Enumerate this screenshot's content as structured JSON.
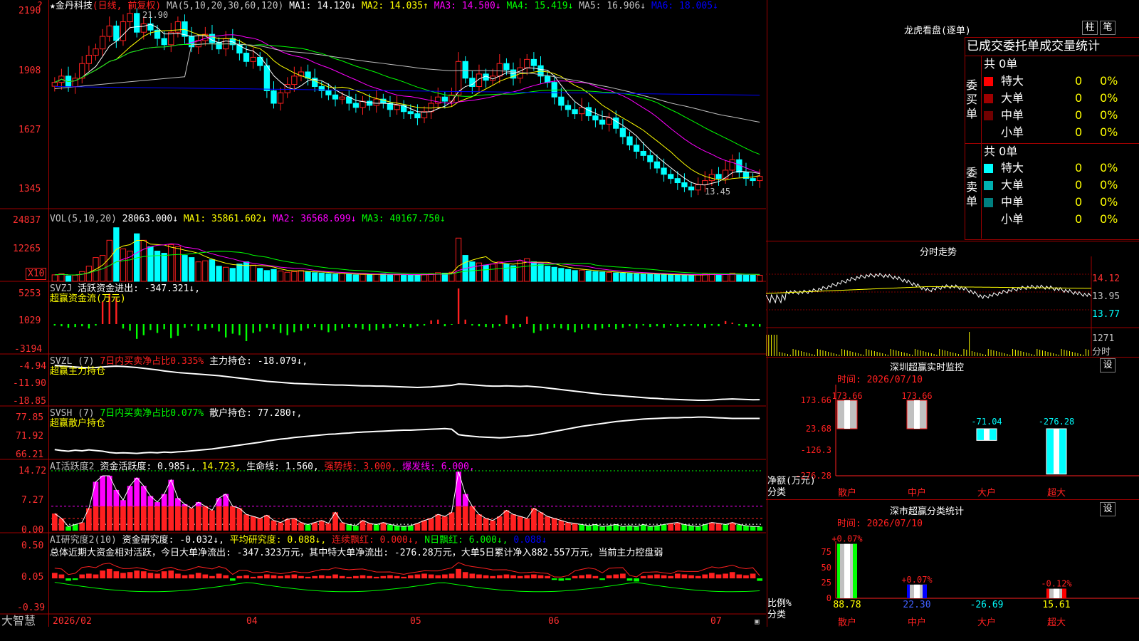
{
  "colors": {
    "up": "#ff2020",
    "down": "#00ffff",
    "bg": "#000000",
    "grid": "#800000",
    "ma5": "#ffffff",
    "ma10": "#ffff00",
    "ma20": "#ff00ff",
    "ma30": "#00ff00",
    "ma60": "#c0c0c0",
    "ma120": "#0000ff",
    "in": "#ff2020",
    "out": "#00ff00"
  },
  "brand": "大智慧",
  "main": {
    "stock_prefix": "★",
    "stock": "金丹科技",
    "mode": "(日线, 前复权)",
    "ma_label": "MA(5,10,20,30,60,120)",
    "ma_vals": [
      "MA1: 14.120↓",
      "MA2: 14.035↑",
      "MA3: 14.500↓",
      "MA4: 15.419↓",
      "MA5: 16.906↓",
      "MA6: 18.005↓"
    ],
    "y_ticks": [
      "2190",
      "1908",
      "1627",
      "1345"
    ],
    "high_label": "21.90",
    "low_label": "13.45",
    "corner": "?"
  },
  "vol": {
    "label": "VOL(5,10,20)",
    "val": "28063.000↓",
    "ma1": "MA1: 35861.602↓",
    "ma2": "MA2: 36568.699↓",
    "ma3": "MA3: 40167.750↓",
    "ticks": [
      "24837",
      "12265"
    ],
    "unit": "X10"
  },
  "svzj": {
    "label": "SVZJ",
    "title": "活跃资金进出:",
    "val": "-347.321↓,",
    "sub": "超赢资金流(万元)",
    "ticks": [
      "5253",
      "1029",
      "-3194"
    ]
  },
  "svzl": {
    "label": "SVZL (7)",
    "desc": "7日内买卖净占比0.335%",
    "hold": "主力持仓: -18.079↓,",
    "sub": "超赢主力持仓",
    "ticks": [
      "-4.94",
      "-11.90",
      "-18.85"
    ]
  },
  "svsh": {
    "label": "SVSH (7)",
    "desc": "7日内买卖净占比0.077%",
    "hold": "散户持仓: 77.280↑,",
    "sub": "超赢散户持仓",
    "ticks": [
      "77.85",
      "71.92",
      "66.21"
    ]
  },
  "ai1": {
    "label": "AI活跃度2",
    "v1": "资金活跃度: 0.985↓,",
    "v2": "14.723,",
    "v3": "生命线: 1.560,",
    "v4": "强势线: 3.000,",
    "v5": "爆发线: 6.000,",
    "ticks": [
      "14.72",
      "7.27",
      "0.00"
    ]
  },
  "ai2": {
    "label": "AI研究度2(10)",
    "v1": "资金研究度: -0.032↓,",
    "v2": "平均研究度: 0.088↓,",
    "v3": "连续飘红: 0.000↓,",
    "v4": "N日飘红: 6.000↓,",
    "v5": "0.088↓",
    "comment": "总体近期大资金相对活跃，今日大单净流出: -347.323万元，其中特大单净流出: -276.28万元，大单5日累计净入882.557万元，当前主力控盘弱",
    "ticks": [
      "0.50",
      "0.05",
      "-0.39"
    ]
  },
  "xaxis": {
    "labels": [
      "2026/02",
      "04",
      "05",
      "06",
      "07"
    ]
  },
  "dragon": {
    "title": "龙虎看盘(逐单)",
    "btn1": "柱",
    "btn2": "笔",
    "subtitle": "已成交委托单成交量统计",
    "buy": {
      "side": "委买单",
      "total": "共 0单",
      "rows": [
        {
          "name": "特大",
          "n": "0",
          "p": "0%",
          "color": "#ff0000"
        },
        {
          "name": "大单",
          "n": "0",
          "p": "0%",
          "color": "#a00000"
        },
        {
          "name": "中单",
          "n": "0",
          "p": "0%",
          "color": "#700000"
        },
        {
          "name": "小单",
          "n": "0",
          "p": "0%",
          "color": ""
        }
      ]
    },
    "sell": {
      "side": "委卖单",
      "total": "共 0单",
      "rows": [
        {
          "name": "特大",
          "n": "0",
          "p": "0%",
          "color": "#00ffff"
        },
        {
          "name": "大单",
          "n": "0",
          "p": "0%",
          "color": "#00b0b0"
        },
        {
          "name": "中单",
          "n": "0",
          "p": "0%",
          "color": "#008080"
        },
        {
          "name": "小单",
          "n": "0",
          "p": "0%",
          "color": ""
        }
      ]
    }
  },
  "intraday": {
    "title": "分时走势",
    "ticks": [
      "14.12",
      "13.95",
      "13.77"
    ],
    "vol_tick": "1271",
    "vol_unit": "分时"
  },
  "monitor": {
    "title": "深圳超赢实时监控",
    "btn": "设",
    "time": "时间: 2026/07/10",
    "ylabel": "净额(万元)",
    "xlabel": "分类",
    "ticks": [
      "173.66",
      "23.68",
      "-126.3",
      "-276.28"
    ],
    "bars": [
      {
        "cat": "散户",
        "value": 173.66,
        "label": "173.66"
      },
      {
        "cat": "中户",
        "value": 173.66,
        "label": "173.66"
      },
      {
        "cat": "大户",
        "value": -71.04,
        "label": "-71.04"
      },
      {
        "cat": "超大",
        "value": -276.28,
        "label": "-276.28"
      }
    ]
  },
  "stats": {
    "title": "深市超赢分类统计",
    "btn": "设",
    "time": "时间: 2026/07/10",
    "ylabel": "比例%",
    "xlabel": "分类",
    "ticks": [
      "75",
      "50",
      "25",
      "0"
    ],
    "bars": [
      {
        "cat": "散户",
        "value": 88.78,
        "top": "+0.07%",
        "label": "88.78",
        "color": "#00ff00"
      },
      {
        "cat": "中户",
        "value": 22.3,
        "top": "+0.07%",
        "label": "22.30",
        "color": "#0000ff"
      },
      {
        "cat": "大户",
        "value": -26.69,
        "top": "",
        "label": "-26.69",
        "color": "#00ffff"
      },
      {
        "cat": "超大",
        "value": 15.61,
        "top": "-0.12%",
        "label": "15.61",
        "color": "#ff0000"
      }
    ]
  },
  "chart_data": [
    {
      "type": "candlestick",
      "title": "金丹科技 日线",
      "ylim": [
        13.0,
        22.2
      ],
      "y_ticks": [
        21.9,
        19.08,
        16.27,
        13.45
      ],
      "closes": [
        18.6,
        18.9,
        18.4,
        18.8,
        19.5,
        19.9,
        20.2,
        20.8,
        21.3,
        20.6,
        21.5,
        21.9,
        21.0,
        21.4,
        21.1,
        20.7,
        20.4,
        21.0,
        21.5,
        20.8,
        20.3,
        20.6,
        20.9,
        20.5,
        20.2,
        20.7,
        20.4,
        20.0,
        19.6,
        19.8,
        19.4,
        18.2,
        17.6,
        18.1,
        18.5,
        18.9,
        19.1,
        18.8,
        18.4,
        18.2,
        18.0,
        17.8,
        17.9,
        17.6,
        17.4,
        17.7,
        17.5,
        17.8,
        17.6,
        17.3,
        17.5,
        17.2,
        17.1,
        16.9,
        17.2,
        17.6,
        17.9,
        17.7,
        18.0,
        19.6,
        18.8,
        18.4,
        19.0,
        18.7,
        18.9,
        19.5,
        19.2,
        18.8,
        19.3,
        19.7,
        19.4,
        18.9,
        18.6,
        17.9,
        17.5,
        17.3,
        17.1,
        17.4,
        17.0,
        16.8,
        16.6,
        16.9,
        16.4,
        16.0,
        15.6,
        15.3,
        15.1,
        14.8,
        14.5,
        14.2,
        14.0,
        13.8,
        13.6,
        13.45,
        13.7,
        13.9,
        14.2,
        14.0,
        14.4,
        14.9,
        14.3,
        14.0,
        13.9,
        14.1
      ],
      "series": [
        {
          "name": "MA1",
          "values": []
        },
        {
          "name": "MA2",
          "values": []
        }
      ]
    },
    {
      "type": "bar",
      "title": "VOL",
      "ylim": [
        0,
        28000
      ],
      "values": [
        3000,
        3500,
        2500,
        2800,
        4500,
        7000,
        11000,
        12000,
        19000,
        24800,
        15000,
        14000,
        22000,
        19000,
        16000,
        14000,
        13000,
        17000,
        16000,
        12000,
        11000,
        9000,
        9500,
        10000,
        7000,
        6500,
        6000,
        8000,
        9000,
        7500,
        6000,
        5000,
        5500,
        4800,
        4200,
        4500,
        5000,
        4300,
        4000,
        3800,
        3500,
        3300,
        3600,
        3400,
        3000,
        3200,
        3100,
        3300,
        3500,
        3200,
        3000,
        2900,
        2800,
        3100,
        3400,
        3600,
        4000,
        3800,
        4200,
        20000,
        12000,
        9000,
        8500,
        7500,
        8000,
        9000,
        8000,
        7200,
        9500,
        10500,
        9000,
        8000,
        7000,
        6500,
        6000,
        5500,
        5000,
        5200,
        4800,
        4500,
        4300,
        4100,
        3900,
        3800,
        3600,
        3400,
        3300,
        3500,
        3200,
        3100,
        3000,
        2900,
        3000,
        2800,
        3100,
        3300,
        3600,
        3200,
        3400,
        3800,
        3100,
        2900,
        2800,
        2806
      ]
    },
    {
      "type": "bar",
      "title": "活跃资金进出",
      "ylim": [
        -3194,
        5253
      ],
      "values": [
        -200,
        -300,
        -500,
        -400,
        -300,
        -600,
        -200,
        3000,
        4100,
        3500,
        -600,
        -900,
        -2000,
        -1500,
        -800,
        -1200,
        -700,
        -1900,
        -1600,
        -500,
        -300,
        -900,
        -700,
        -500,
        -1000,
        -1800,
        -1300,
        -1500,
        -2300,
        -1200,
        -1000,
        -500,
        -700,
        -1200,
        -1500,
        -1100,
        -900,
        -600,
        -400,
        -800,
        -1100,
        -900,
        -600,
        -400,
        -500,
        -700,
        -900,
        -800,
        -600,
        -500,
        -300,
        -400,
        -500,
        -300,
        -200,
        500,
        600,
        -300,
        -100,
        4800,
        600,
        -200,
        -300,
        -400,
        -500,
        -300,
        1200,
        -600,
        -400,
        1000,
        -1200,
        -900,
        -700,
        -500,
        -600,
        -800,
        -1100,
        -700,
        -500,
        -800,
        -600,
        -400,
        -700,
        -500,
        -300,
        -600,
        -200,
        -400,
        -300,
        -500,
        -200,
        -400,
        -300,
        -200,
        -300,
        -500,
        -200,
        -300,
        400,
        200,
        -200,
        -400,
        -300,
        -347
      ]
    },
    {
      "type": "line",
      "title": "主力持仓",
      "ylim": [
        -18.85,
        -4.94
      ],
      "values": [
        -5.2,
        -5.4,
        -5.6,
        -5.8,
        -6.0,
        -6.1,
        -6.0,
        -5.8,
        -5.6,
        -5.5,
        -5.6,
        -5.8,
        -6.0,
        -6.3,
        -6.6,
        -6.9,
        -7.3,
        -7.6,
        -7.9,
        -8.1,
        -8.3,
        -8.5,
        -8.7,
        -8.9,
        -9.1,
        -9.4,
        -9.7,
        -10.0,
        -10.3,
        -10.6,
        -10.9,
        -11.2,
        -11.4,
        -11.6,
        -11.8,
        -12.0,
        -12.1,
        -12.2,
        -12.3,
        -12.4,
        -12.5,
        -12.6,
        -12.6,
        -12.7,
        -12.8,
        -12.9,
        -12.9,
        -13.0,
        -13.0,
        -13.1,
        -13.2,
        -13.3,
        -13.4,
        -13.5,
        -13.4,
        -13.3,
        -13.1,
        -12.9,
        -12.7,
        -12.2,
        -12.3,
        -12.5,
        -12.7,
        -12.9,
        -13.0,
        -13.0,
        -12.9,
        -13.0,
        -13.1,
        -13.0,
        -13.2,
        -13.4,
        -13.7,
        -14.0,
        -14.3,
        -14.6,
        -14.9,
        -15.2,
        -15.5,
        -15.8,
        -16.1,
        -16.3,
        -16.5,
        -16.7,
        -16.9,
        -17.1,
        -17.3,
        -17.5,
        -17.6,
        -17.8,
        -17.9,
        -18.0,
        -18.1,
        -18.2,
        -18.3,
        -18.3,
        -18.2,
        -18.0,
        -17.9,
        -17.8,
        -17.9,
        -18.0,
        -18.1,
        -18.079
      ]
    },
    {
      "type": "line",
      "title": "散户持仓",
      "ylim": [
        66.21,
        77.85
      ],
      "values": [
        67.5,
        67.2,
        67.0,
        67.3,
        67.1,
        67.4,
        67.2,
        67.0,
        66.6,
        66.4,
        66.5,
        66.4,
        66.3,
        66.5,
        66.6,
        66.5,
        66.7,
        66.6,
        66.8,
        66.9,
        67.1,
        67.3,
        67.5,
        67.7,
        68.0,
        68.3,
        68.6,
        68.9,
        69.2,
        69.5,
        69.8,
        70.2,
        70.5,
        70.8,
        71.0,
        71.3,
        71.5,
        71.7,
        71.9,
        72.1,
        72.3,
        72.4,
        72.6,
        72.7,
        72.9,
        73.0,
        73.1,
        73.2,
        73.3,
        73.4,
        73.5,
        73.6,
        73.6,
        73.7,
        73.8,
        73.9,
        74.0,
        74.1,
        73.9,
        72.2,
        71.9,
        71.7,
        71.5,
        71.4,
        71.3,
        71.2,
        71.3,
        71.5,
        71.7,
        71.8,
        72.1,
        72.4,
        72.8,
        73.2,
        73.6,
        74.0,
        74.4,
        74.8,
        75.1,
        75.4,
        75.7,
        76.0,
        76.3,
        76.5,
        76.7,
        76.9,
        77.1,
        77.2,
        77.3,
        77.4,
        77.5,
        77.5,
        77.6,
        77.6,
        77.7,
        77.7,
        77.6,
        77.5,
        77.4,
        77.3,
        77.3,
        77.3,
        77.3,
        77.28
      ]
    },
    {
      "type": "bar",
      "title": "AI活跃度2",
      "ylim": [
        0,
        14.72
      ],
      "values": [
        4.2,
        3.0,
        1.0,
        1.5,
        2.0,
        5.5,
        12.0,
        13.5,
        13.5,
        10.0,
        7.5,
        11.0,
        13.0,
        11.0,
        8.5,
        7.0,
        9.0,
        12.5,
        8.0,
        6.5,
        5.5,
        7.0,
        6.0,
        5.0,
        8.0,
        9.0,
        6.0,
        5.5,
        4.0,
        3.5,
        3.0,
        3.8,
        2.5,
        2.0,
        2.8,
        3.0,
        2.0,
        1.5,
        2.0,
        2.5,
        1.8,
        4.5,
        2.0,
        1.5,
        1.2,
        2.5,
        1.8,
        1.5,
        2.0,
        1.5,
        1.2,
        1.0,
        1.2,
        1.8,
        2.5,
        3.0,
        4.0,
        3.5,
        4.5,
        14.5,
        9.0,
        6.0,
        4.0,
        3.0,
        2.5,
        3.5,
        5.0,
        4.0,
        3.5,
        3.0,
        5.5,
        4.5,
        3.5,
        3.0,
        2.5,
        2.0,
        1.8,
        1.5,
        1.2,
        1.5,
        1.0,
        1.2,
        1.5,
        1.0,
        1.2,
        1.0,
        1.5,
        1.0,
        1.2,
        1.5,
        1.8,
        2.0,
        1.5,
        1.2,
        1.0,
        1.5,
        2.0,
        1.8,
        1.5,
        2.0,
        1.5,
        1.2,
        1.0,
        0.985
      ],
      "lines": {
        "强势线": 3.0,
        "爆发线": 6.0,
        "生命线": 1.56
      }
    },
    {
      "type": "bar",
      "title": "AI研究度2(10)",
      "ylim": [
        -0.39,
        0.5
      ],
      "values": [
        0.07,
        0.05,
        -0.03,
        -0.02,
        0.05,
        0.06,
        0.05,
        0.1,
        0.12,
        0.09,
        0.07,
        0.08,
        0.1,
        0.09,
        0.07,
        0.06,
        0.09,
        0.1,
        0.06,
        0.04,
        0.05,
        0.07,
        0.05,
        0.03,
        0.06,
        0.04,
        -0.03,
        0.03,
        0.04,
        0.02,
        0.03,
        0.05,
        0.04,
        0.03,
        0.04,
        0.05,
        0.03,
        0.02,
        0.03,
        0.04,
        0.03,
        0.05,
        0.03,
        0.02,
        0.03,
        0.04,
        0.03,
        0.02,
        0.03,
        0.04,
        0.03,
        0.02,
        0.04,
        0.05,
        0.06,
        0.05,
        0.04,
        0.05,
        0.06,
        0.12,
        0.08,
        0.06,
        0.05,
        0.04,
        0.03,
        0.04,
        0.05,
        0.04,
        0.03,
        0.04,
        0.05,
        0.04,
        0.03,
        -0.02,
        -0.03,
        -0.02,
        0.03,
        0.04,
        0.05,
        0.03,
        -0.02,
        0.04,
        0.05,
        0.06,
        -0.03,
        -0.04,
        0.03,
        0.04,
        0.05,
        0.04,
        0.03,
        0.06,
        0.05,
        0.04,
        0.03,
        0.05,
        0.07,
        0.05,
        0.06,
        0.08,
        0.05,
        0.04,
        0.06,
        -0.032
      ]
    }
  ]
}
